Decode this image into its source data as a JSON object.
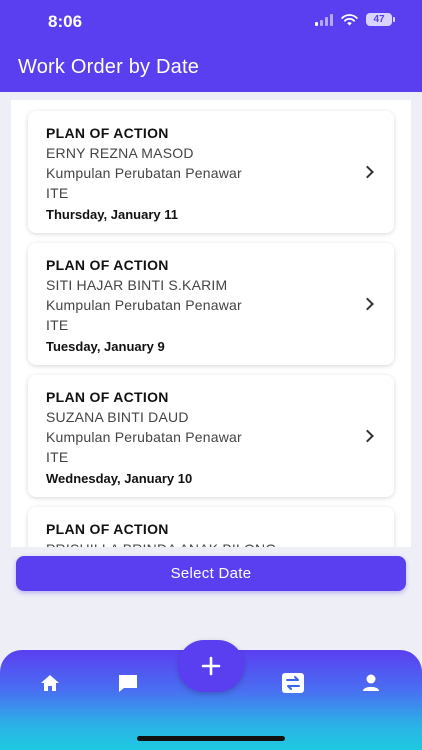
{
  "status_bar": {
    "time": "8:06",
    "battery": "47"
  },
  "header": {
    "title": "Work Order by Date"
  },
  "work_orders": [
    {
      "title": "PLAN OF ACTION",
      "name": "ERNY REZNA MASOD",
      "group": "Kumpulan Perubatan Penawar",
      "dept": "ITE",
      "date": "Thursday, January 11"
    },
    {
      "title": "PLAN OF ACTION",
      "name": "SITI HAJAR BINTI S.KARIM",
      "group": "Kumpulan Perubatan Penawar",
      "dept": "ITE",
      "date": "Tuesday, January 9"
    },
    {
      "title": "PLAN OF ACTION",
      "name": "SUZANA BINTI DAUD",
      "group": "Kumpulan Perubatan Penawar",
      "dept": "ITE",
      "date": "Wednesday, January 10"
    },
    {
      "title": "PLAN OF ACTION",
      "name": "PRISHILLA BRINDA ANAK BILONG",
      "group": "",
      "dept": "",
      "date": ""
    }
  ],
  "actions": {
    "select_date": "Select Date"
  },
  "bottom_nav": {
    "items": [
      "home-icon",
      "chat-icon",
      "add-icon",
      "switch-icon",
      "profile-icon"
    ]
  },
  "colors": {
    "primary": "#5a3ff0",
    "nav_gradient_end": "#1ec8e0",
    "background": "#eeeef6"
  }
}
